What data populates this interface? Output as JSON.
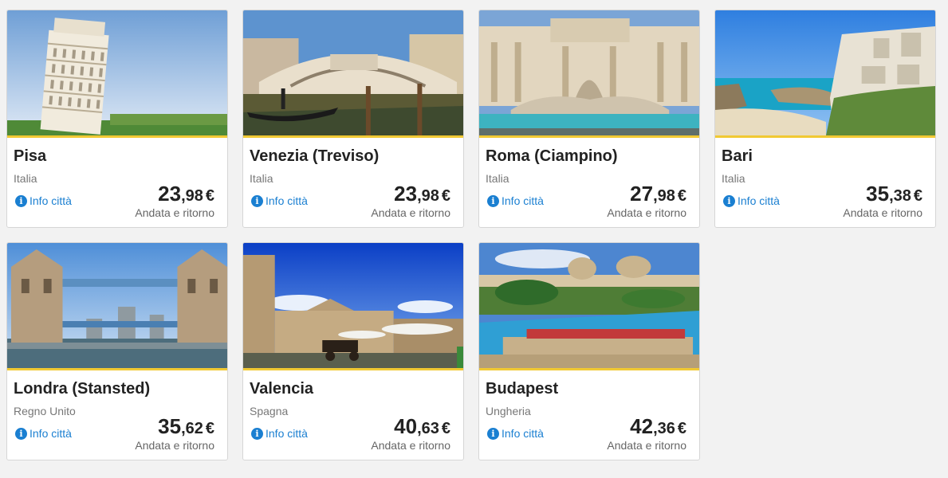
{
  "info_label": "Info città",
  "accent_color": "#f1c933",
  "info_color": "#1a7fd1",
  "destinations": [
    {
      "city": "Pisa",
      "country": "Italia",
      "price_int": "23",
      "price_dec": ",98",
      "currency": "€",
      "trip": "Andata e ritorno"
    },
    {
      "city": "Venezia (Treviso)",
      "country": "Italia",
      "price_int": "23",
      "price_dec": ",98",
      "currency": "€",
      "trip": "Andata e ritorno"
    },
    {
      "city": "Roma (Ciampino)",
      "country": "Italia",
      "price_int": "27",
      "price_dec": ",98",
      "currency": "€",
      "trip": "Andata e ritorno"
    },
    {
      "city": "Bari",
      "country": "Italia",
      "price_int": "35",
      "price_dec": ",38",
      "currency": "€",
      "trip": "Andata e ritorno"
    },
    {
      "city": "Londra (Stansted)",
      "country": "Regno Unito",
      "price_int": "35",
      "price_dec": ",62",
      "currency": "€",
      "trip": "Andata e ritorno"
    },
    {
      "city": "Valencia",
      "country": "Spagna",
      "price_int": "40",
      "price_dec": ",63",
      "currency": "€",
      "trip": "Andata e ritorno"
    },
    {
      "city": "Budapest",
      "country": "Ungheria",
      "price_int": "42",
      "price_dec": ",36",
      "currency": "€",
      "trip": "Andata e ritorno"
    }
  ]
}
